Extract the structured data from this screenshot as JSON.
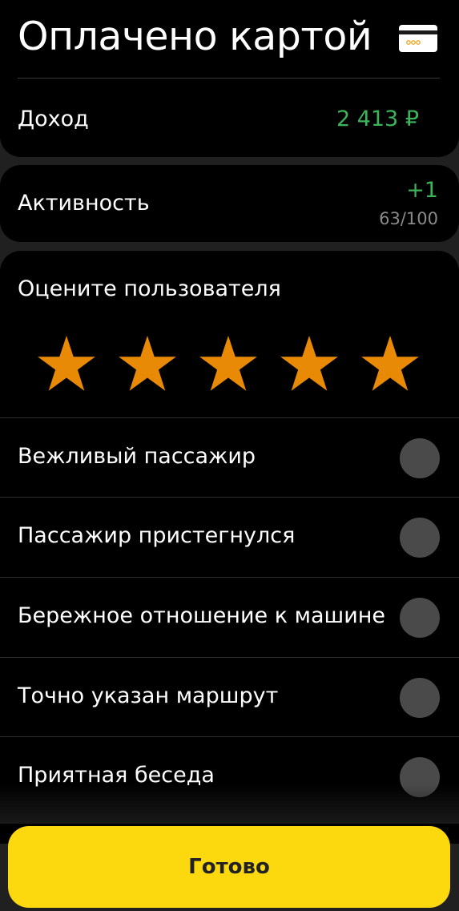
{
  "payment": {
    "title": "Оплачено картой",
    "icon": "credit-card-icon"
  },
  "income": {
    "label": "Доход",
    "value": "2 413 ₽",
    "value_color": "#3cb55a"
  },
  "activity": {
    "label": "Активность",
    "delta": "+1",
    "progress": "63/100"
  },
  "rating": {
    "title": "Оцените пользователя",
    "stars_total": 5,
    "stars_selected": 5,
    "star_color": "#e98a07"
  },
  "options": [
    {
      "label": "Вежливый пассажир"
    },
    {
      "label": "Пассажир пристегнулся"
    },
    {
      "label": "Бережное отношение к машине"
    },
    {
      "label": "Точно указан маршрут"
    },
    {
      "label": "Приятная беседа"
    }
  ],
  "done_button": {
    "label": "Готово",
    "color": "#fcd80f"
  }
}
